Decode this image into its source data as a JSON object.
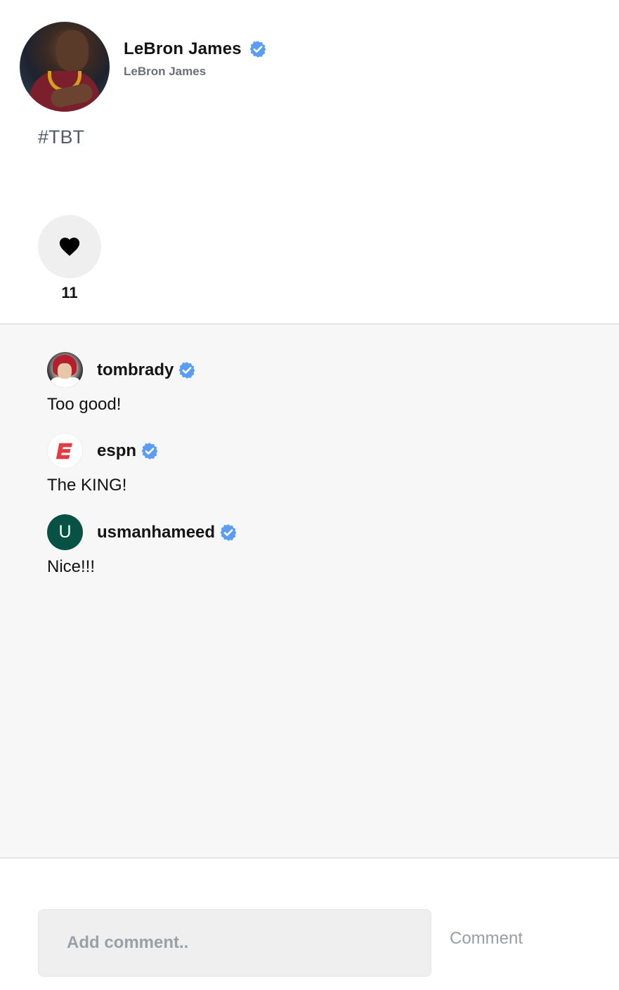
{
  "post": {
    "author_name": "LeBron James",
    "author_handle": "LeBron James",
    "verified": true,
    "caption": "#TBT",
    "like_count": "11"
  },
  "comments": [
    {
      "username": "tombrady",
      "verified": true,
      "text": "Too good!",
      "avatar": "photo"
    },
    {
      "username": "espn",
      "verified": true,
      "text": "The KING!",
      "avatar": "espn-logo"
    },
    {
      "username": "usmanhameed",
      "verified": true,
      "text": "Nice!!!",
      "avatar_letter": "U"
    }
  ],
  "composer": {
    "placeholder": "Add comment..",
    "submit_label": "Comment"
  },
  "colors": {
    "verified_badge": "#5b9cf5",
    "comments_bg": "#f7f7f7",
    "letter_avatar_bg": "#075245",
    "espn_red": "#e53a42"
  },
  "icons": {
    "like": "heart-icon",
    "verified": "verified-badge-icon"
  }
}
